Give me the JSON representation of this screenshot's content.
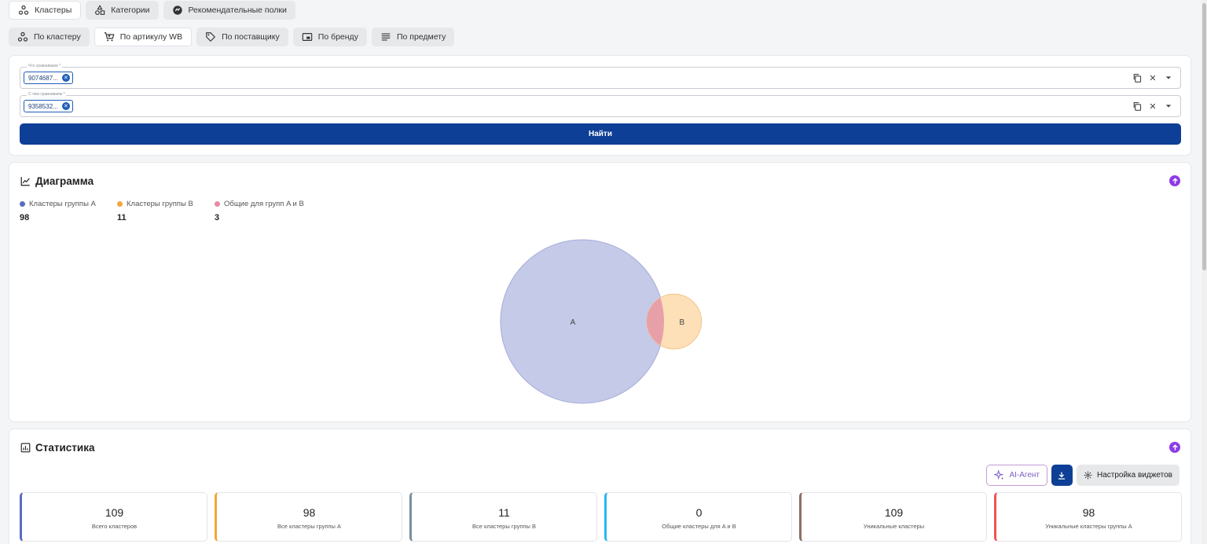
{
  "top_tabs": [
    {
      "label": "Кластеры",
      "icon": "clusters-icon",
      "active": true
    },
    {
      "label": "Категории",
      "icon": "categories-icon",
      "active": false
    },
    {
      "label": "Рекомендательные полки",
      "icon": "shelves-icon",
      "active": false
    }
  ],
  "sub_tabs": [
    {
      "label": "По кластеру",
      "icon": "clusters-icon",
      "active": false
    },
    {
      "label": "По артикулу WB",
      "icon": "cart-icon",
      "active": true
    },
    {
      "label": "По поставщику",
      "icon": "tag-icon",
      "active": false
    },
    {
      "label": "По бренду",
      "icon": "brand-icon",
      "active": false
    },
    {
      "label": "По предмету",
      "icon": "list-icon",
      "active": false
    }
  ],
  "form": {
    "field_a": {
      "label": "Что сравниваем *",
      "chip": "9074687..."
    },
    "field_b": {
      "label": "С чем сравниваем *",
      "chip": "9358532..."
    },
    "submit_label": "Найти"
  },
  "diagram": {
    "title": "Диаграмма",
    "legend": [
      {
        "label": "Кластеры группы A",
        "value": "98",
        "color": "#5c6bc0"
      },
      {
        "label": "Кластеры группы B",
        "value": "11",
        "color": "#f5a53d"
      },
      {
        "label": "Общие для групп A и B",
        "value": "3",
        "color": "#e88aa3"
      }
    ]
  },
  "chart_data": {
    "type": "venn",
    "sets": [
      {
        "name": "A",
        "size": 98,
        "color": "#c5cae9"
      },
      {
        "name": "B",
        "size": 11,
        "color": "#fde0b8"
      }
    ],
    "intersection": {
      "sets": [
        "A",
        "B"
      ],
      "size": 3,
      "color": "#e8a0a8"
    }
  },
  "stats": {
    "title": "Статистика",
    "ai_label": "AI-Агент",
    "settings_label": "Настройка виджетов",
    "kpis": [
      {
        "value": "109",
        "label": "Всего кластеров",
        "color": "#5c6bc0"
      },
      {
        "value": "98",
        "label": "Все кластеры группы A",
        "color": "#f5a53d"
      },
      {
        "value": "11",
        "label": "Все кластеры группы B",
        "color": "#78909c"
      },
      {
        "value": "0",
        "label": "Общие кластеры для A и B",
        "color": "#29b6f6"
      },
      {
        "value": "109",
        "label": "Уникальные кластеры",
        "color": "#8d6e63"
      },
      {
        "value": "98",
        "label": "Уникальные кластеры группы A",
        "color": "#ef5350"
      }
    ]
  }
}
